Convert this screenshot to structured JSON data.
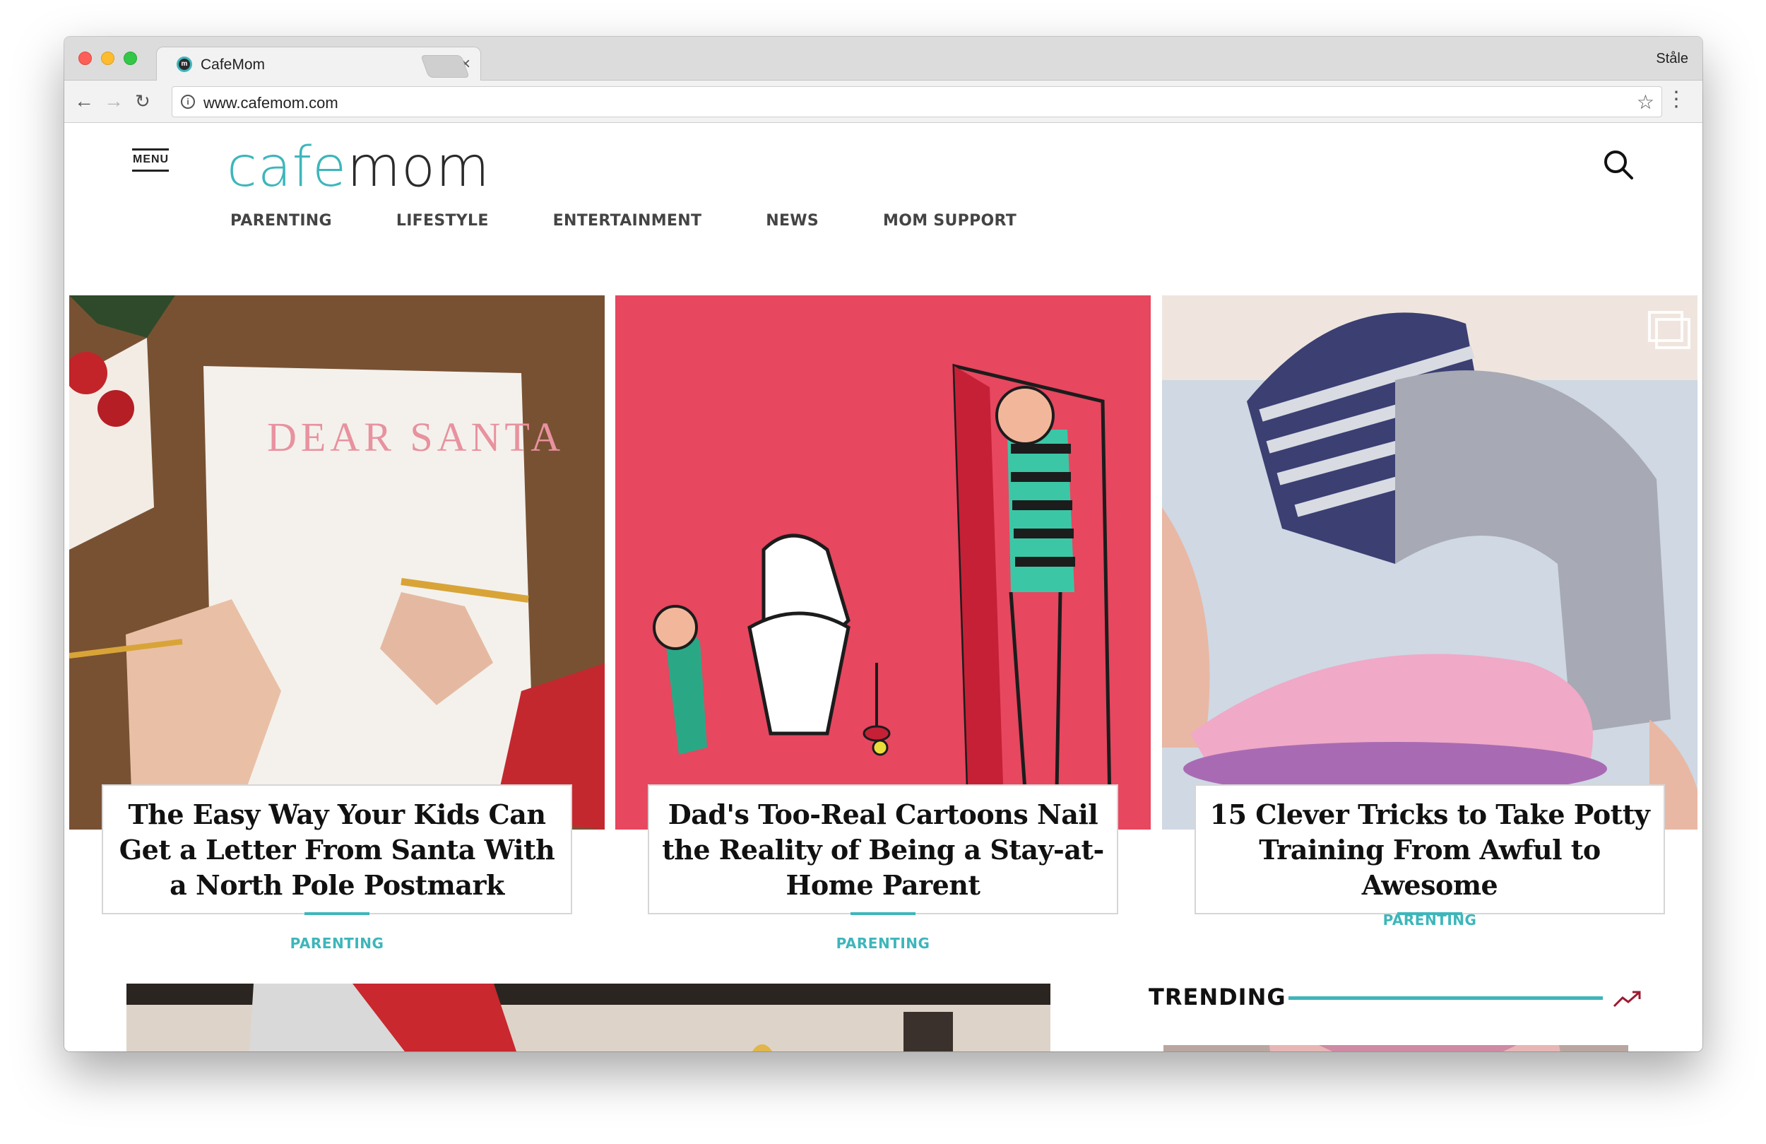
{
  "browser": {
    "tab_title": "CafeMom",
    "tab_close": "×",
    "profile_name": "Ståle",
    "url": "www.cafemom.com",
    "back_icon": "←",
    "forward_icon": "→",
    "reload_icon": "↻",
    "star_icon": "☆",
    "menu_icon": "⋮"
  },
  "site": {
    "menu_label": "MENU",
    "logo_part1": "cafe",
    "logo_part2": "mom",
    "nav": [
      "PARENTING",
      "LIFESTYLE",
      "ENTERTAINMENT",
      "NEWS",
      "MOM SUPPORT"
    ]
  },
  "cards": [
    {
      "title": "The Easy Way Your Kids Can Get a Letter From Santa With a North Pole Postmark",
      "category": "PARENTING",
      "image_text": "DEAR SANTA"
    },
    {
      "title": "Dad's Too-Real Cartoons Nail the Reality of Being a Stay-at-Home Parent",
      "category": "PARENTING"
    },
    {
      "title": "15 Clever Tricks to Take Potty Training From Awful to Awesome",
      "category": "PARENTING"
    }
  ],
  "sidebar": {
    "trending_title": "TRENDING"
  },
  "colors": {
    "brand_teal": "#3db6bb",
    "card_pink": "#e7475f",
    "trending_arrow": "#9b1b30"
  }
}
